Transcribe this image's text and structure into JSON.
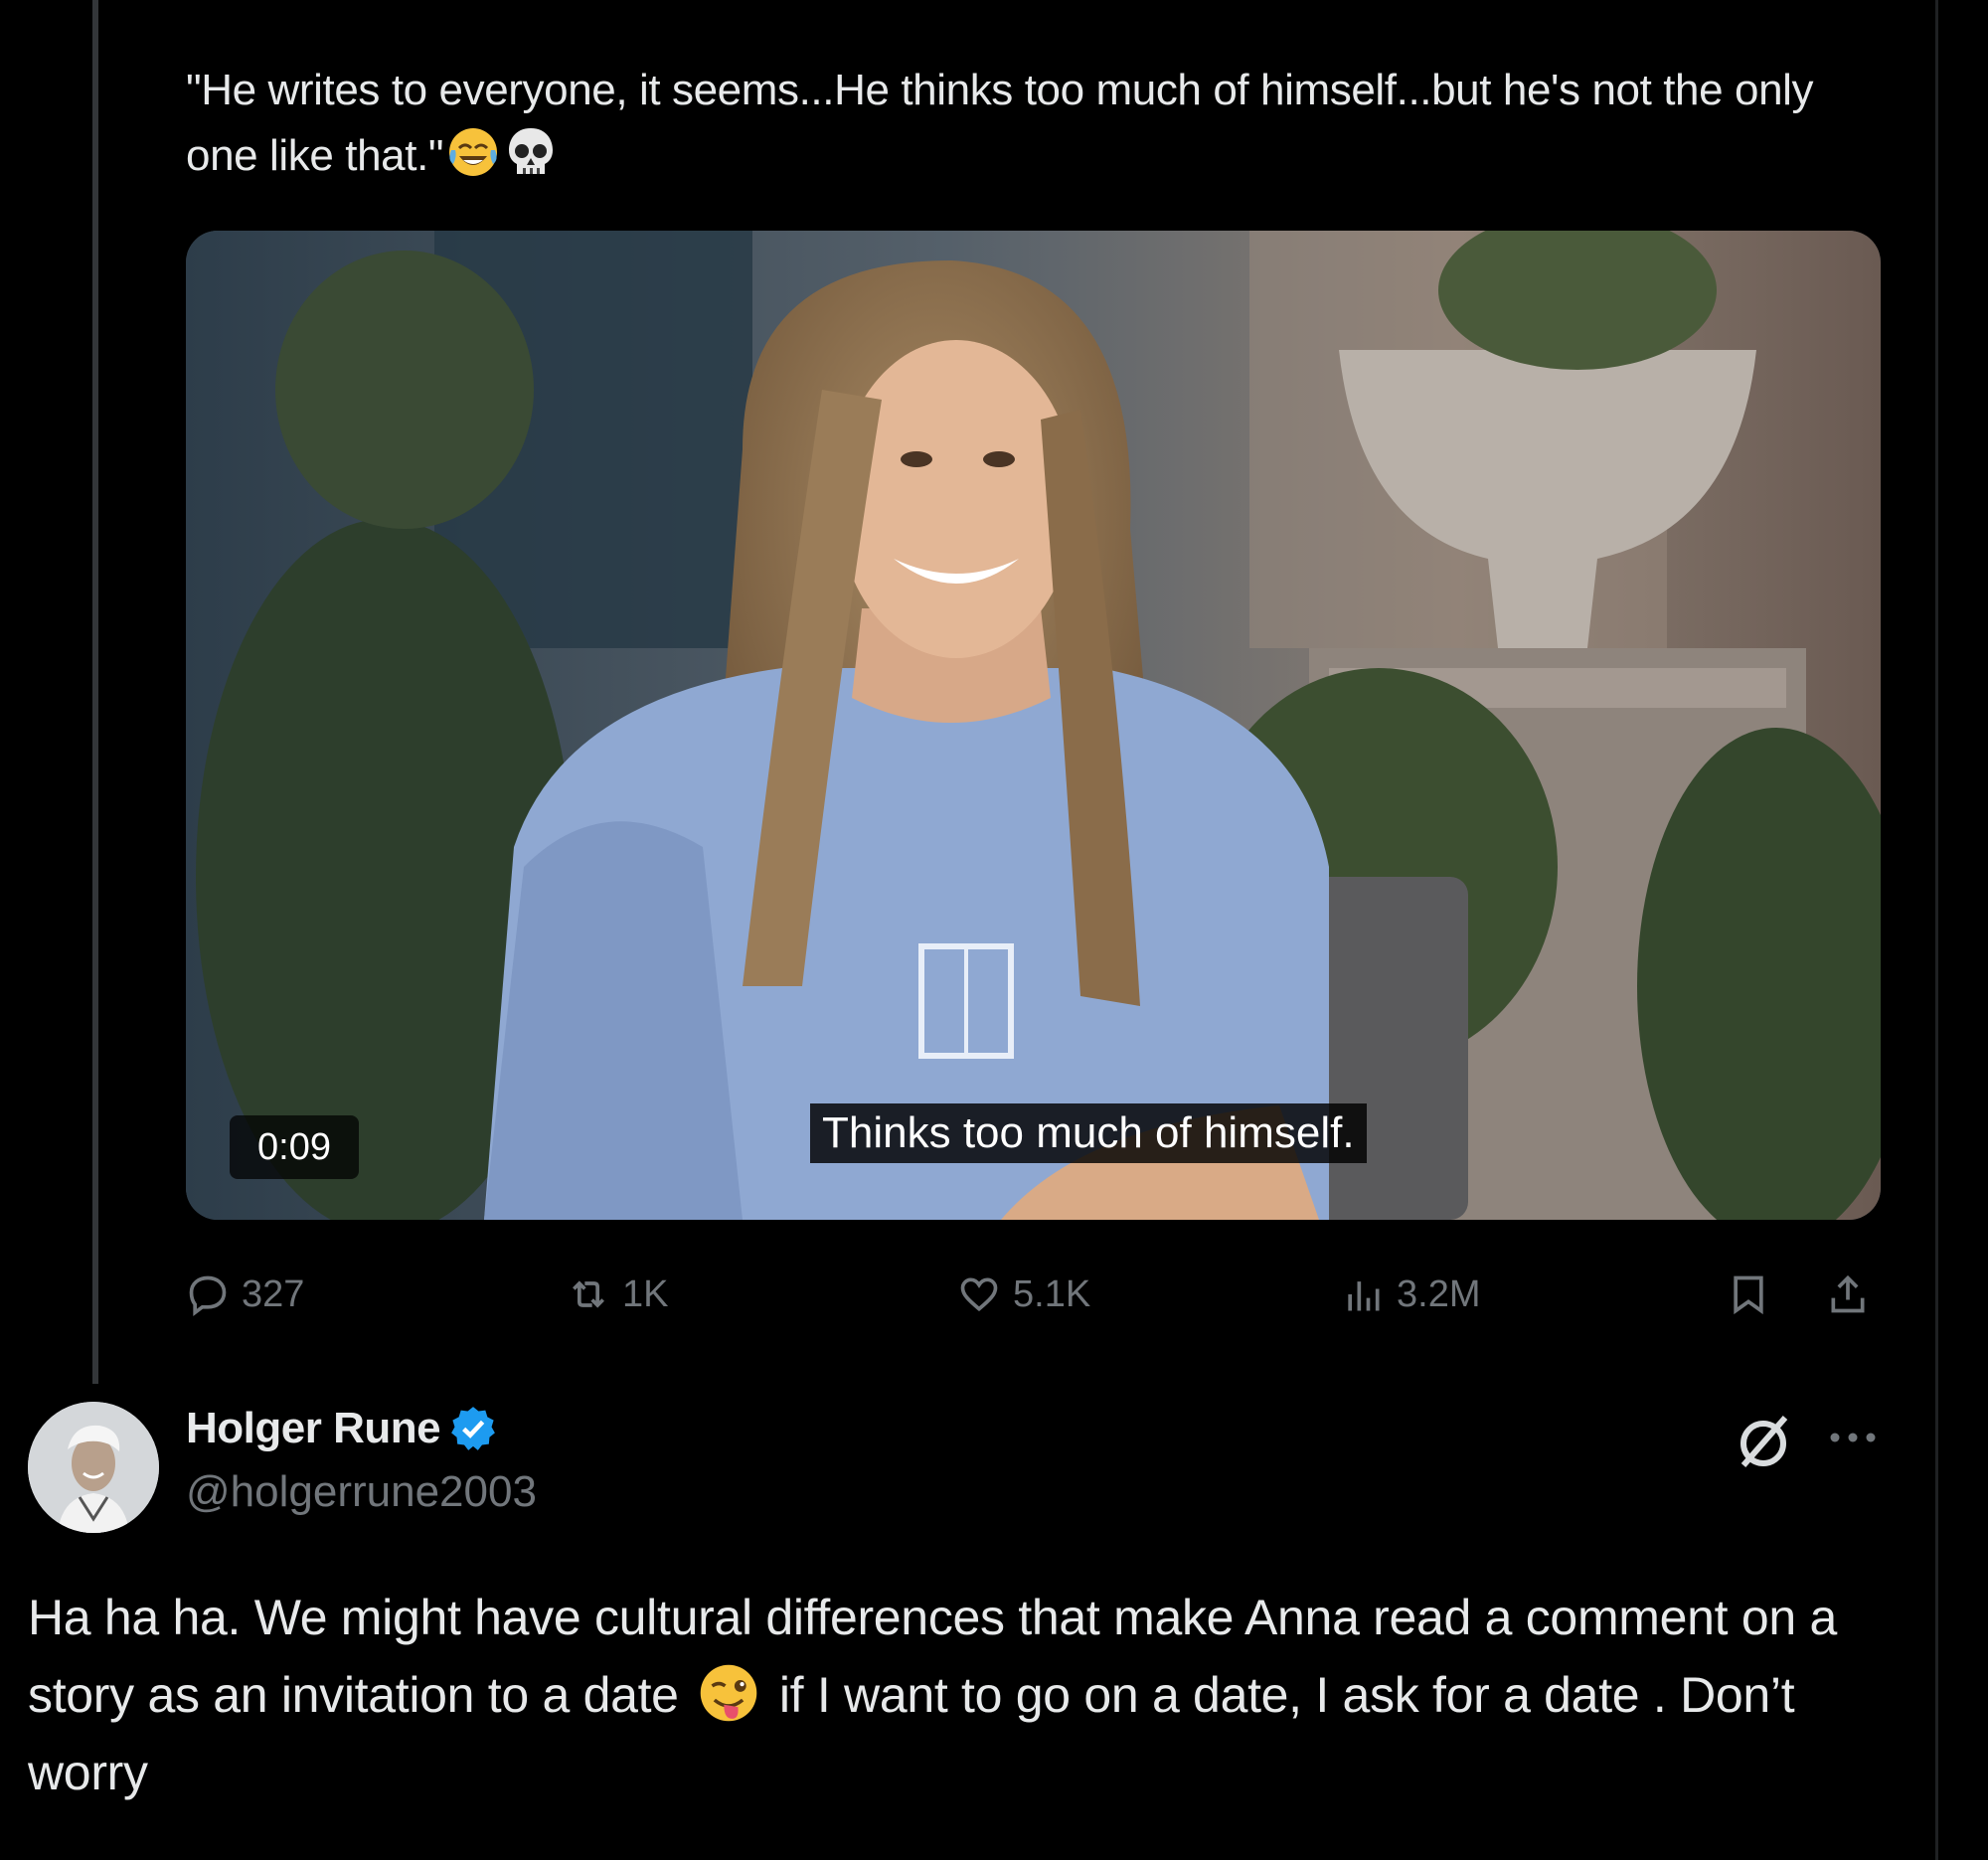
{
  "quoted_tweet": {
    "text": "\"He writes to everyone, it seems...He thinks too much of himself...but he's not the only one like that.\"",
    "emojis": [
      "face-with-tears-of-joy",
      "skull"
    ],
    "video": {
      "timestamp": "0:09",
      "caption": "Thinks too much of himself."
    },
    "actions": {
      "replies": "327",
      "reposts": "1K",
      "likes": "5.1K",
      "views": "3.2M"
    }
  },
  "reply": {
    "display_name": "Holger Rune",
    "handle": "@holgerrune2003",
    "verified": true,
    "text_part1": "Ha ha ha. We might have cultural differences that make Anna read a comment on a story as an invitation to a date",
    "emoji": "winking-face-with-tongue",
    "text_part2": "if I want to go on a date, I ask for a date . Don’t worry"
  },
  "colors": {
    "background": "#000000",
    "text_primary": "#e7e9ea",
    "text_secondary": "#71767b",
    "verified_blue": "#1d9bf0"
  }
}
